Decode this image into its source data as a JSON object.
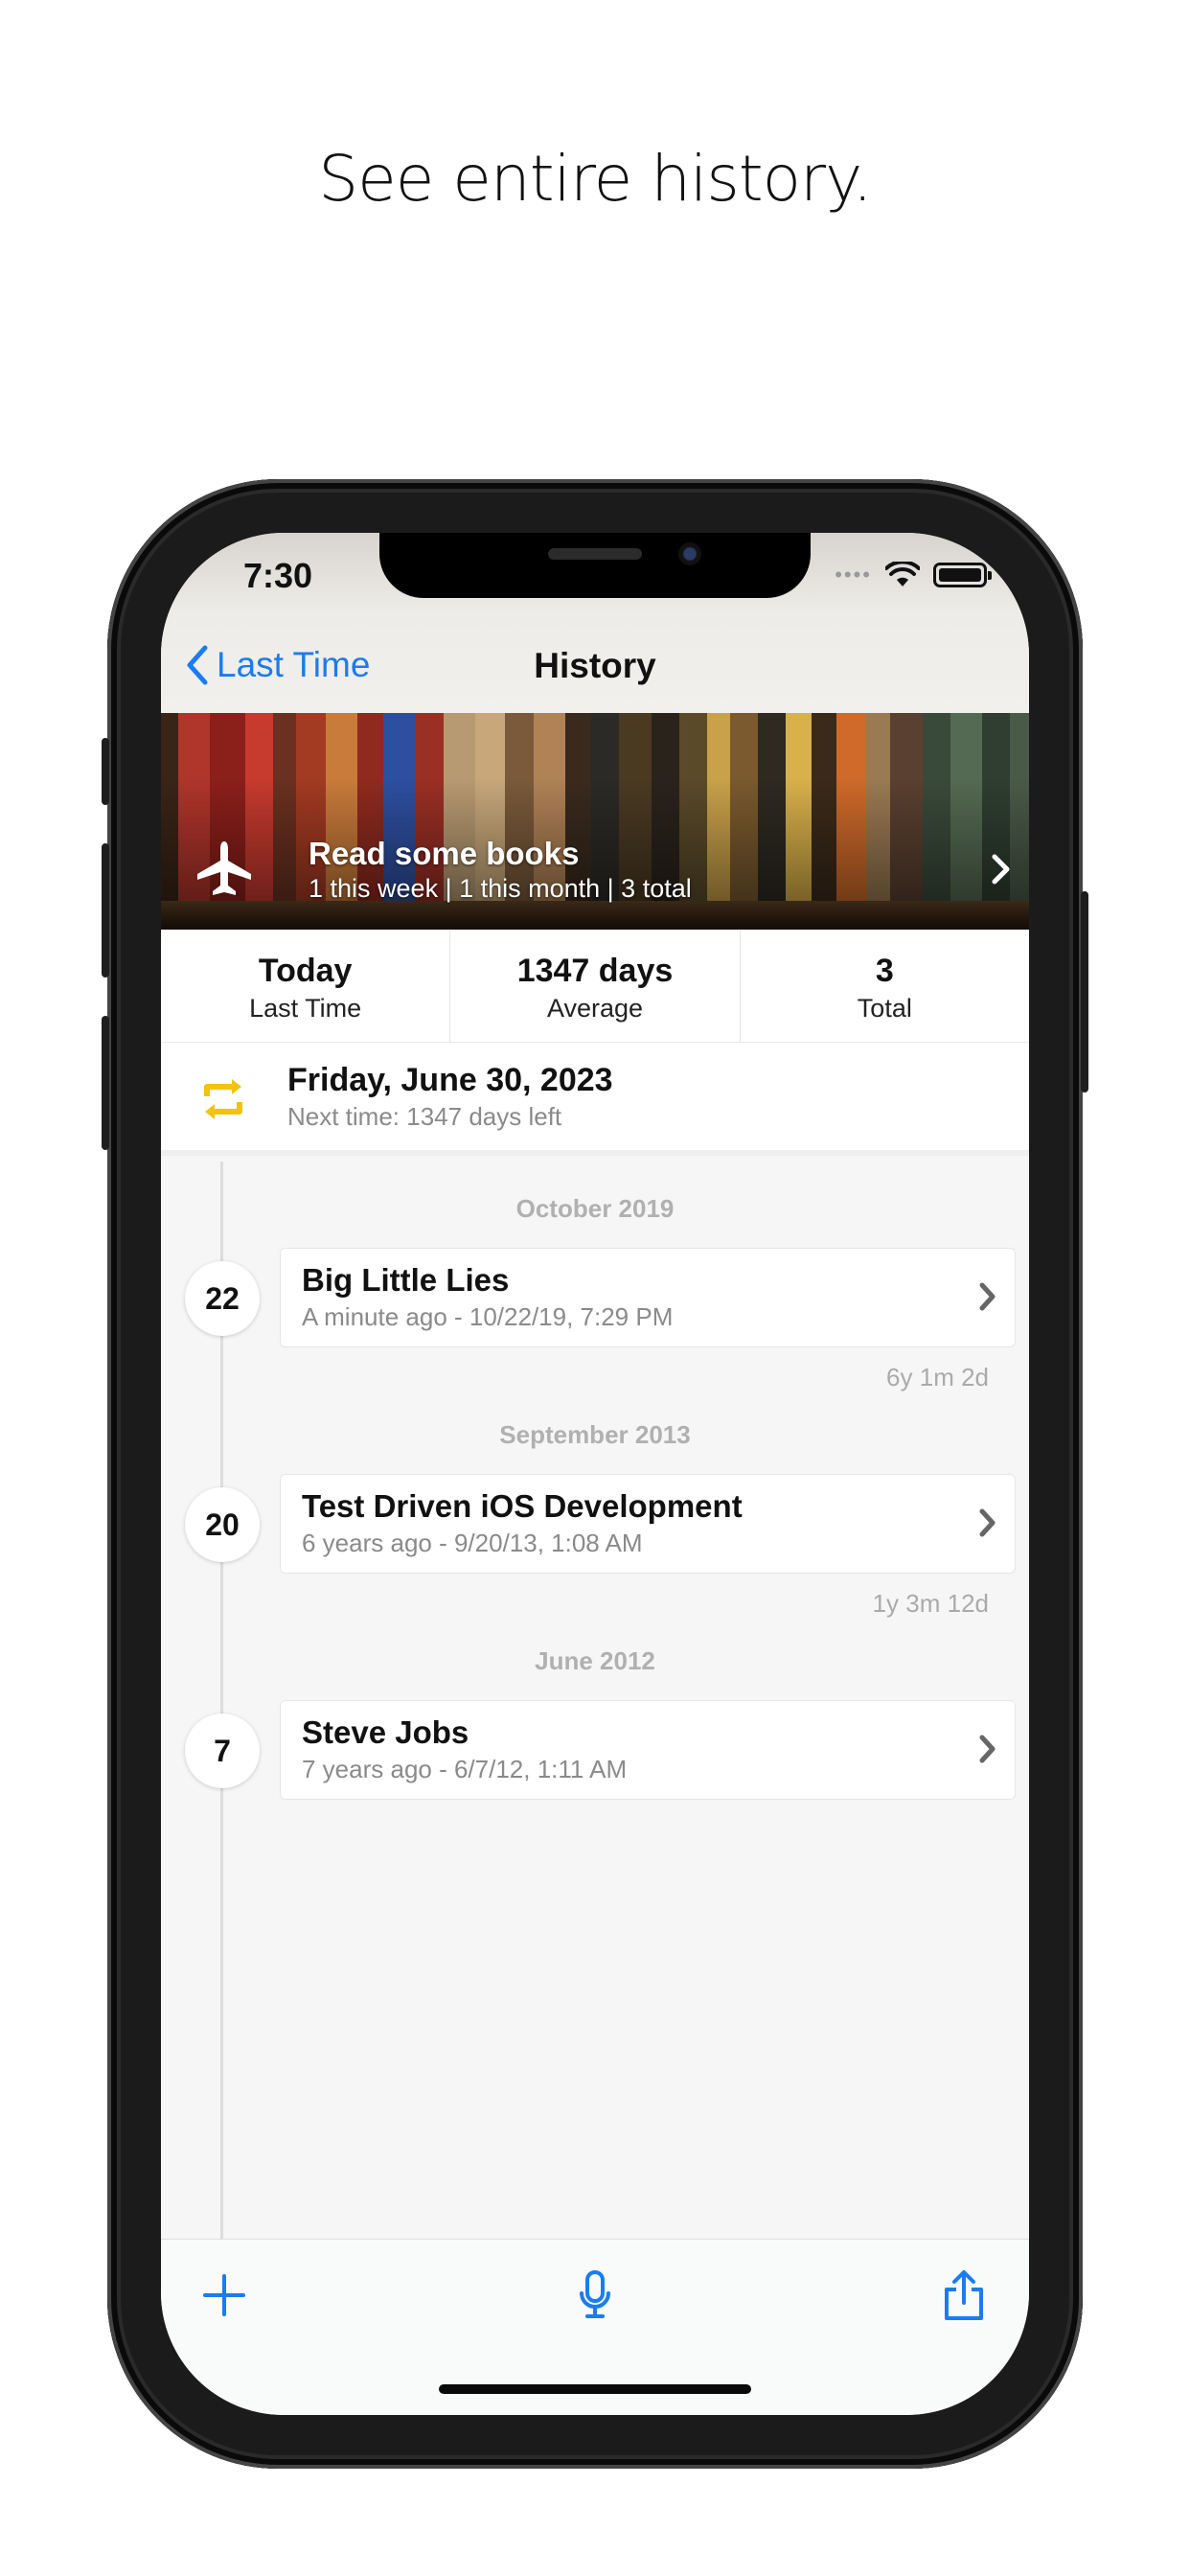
{
  "headline": "See entire history.",
  "status_bar": {
    "time": "7:30",
    "signal_dots": "••••"
  },
  "nav": {
    "back_label": "Last Time",
    "title": "History"
  },
  "banner": {
    "title": "Read some books",
    "subtitle": "1 this week | 1 this month | 3 total",
    "icon": "airplane-icon"
  },
  "stats": [
    {
      "value": "Today",
      "label": "Last Time"
    },
    {
      "value": "1347 days",
      "label": "Average"
    },
    {
      "value": "3",
      "label": "Total"
    }
  ],
  "next": {
    "title": "Friday, June 30, 2023",
    "subtitle": "Next time: 1347 days left",
    "icon": "repeat-icon",
    "icon_color": "#f1c40f"
  },
  "history": [
    {
      "month": "October 2019",
      "day": "22",
      "title": "Big Little Lies",
      "subtitle": "A minute ago - 10/22/19, 7:29 PM",
      "gap": "6y 1m 2d"
    },
    {
      "month": "September 2013",
      "day": "20",
      "title": "Test Driven iOS Development",
      "subtitle": "6 years ago - 9/20/13, 1:08 AM",
      "gap": "1y 3m 12d"
    },
    {
      "month": "June 2012",
      "day": "7",
      "title": "Steve Jobs",
      "subtitle": "7 years ago - 6/7/12, 1:11 AM"
    }
  ],
  "toolbar": {
    "add": "plus-icon",
    "voice": "microphone-icon",
    "share": "share-icon"
  },
  "colors": {
    "accent": "#1a7cf2",
    "muted": "#8a8a8a",
    "month": "#b0b0b0"
  }
}
